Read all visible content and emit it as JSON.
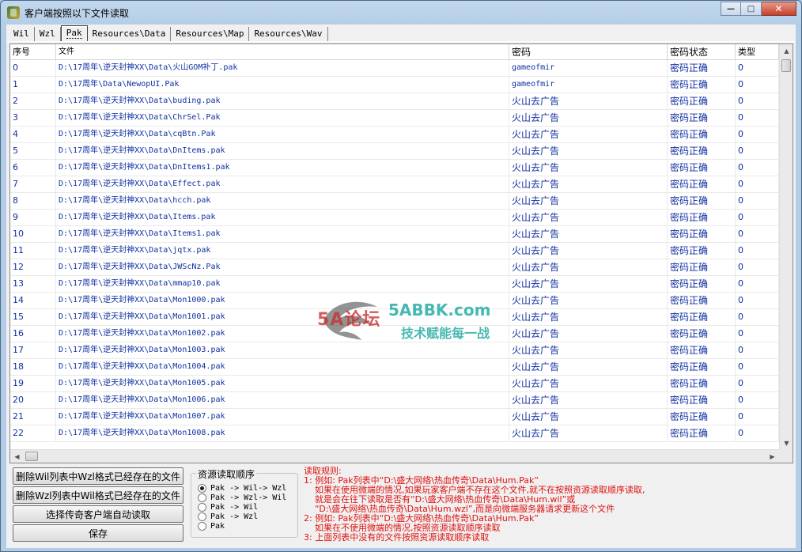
{
  "window": {
    "title": "客户端按照以下文件读取",
    "controls": {
      "minimize": "—",
      "maximize": "□",
      "close": "✕"
    }
  },
  "tabs": [
    {
      "label": "Wil",
      "active": false
    },
    {
      "label": "Wzl",
      "active": false
    },
    {
      "label": "Pak",
      "active": true
    },
    {
      "label": "Resources\\Data",
      "active": false
    },
    {
      "label": "Resources\\Map",
      "active": false
    },
    {
      "label": "Resources\\Wav",
      "active": false
    }
  ],
  "table": {
    "columns": [
      "序号",
      "文件",
      "密码",
      "密码状态",
      "类型"
    ],
    "rows": [
      [
        "0",
        "D:\\17周年\\逆天封神XX\\Data\\火山GOM补丁.pak",
        "gameofmir",
        "密码正确",
        "0"
      ],
      [
        "1",
        "D:\\17周年\\Data\\NewopUI.Pak",
        "gameofmir",
        "密码正确",
        "0"
      ],
      [
        "2",
        "D:\\17周年\\逆天封神XX\\Data\\buding.pak",
        "火山去广告",
        "密码正确",
        "0"
      ],
      [
        "3",
        "D:\\17周年\\逆天封神XX\\Data\\ChrSel.Pak",
        "火山去广告",
        "密码正确",
        "0"
      ],
      [
        "4",
        "D:\\17周年\\逆天封神XX\\Data\\cqBtn.Pak",
        "火山去广告",
        "密码正确",
        "0"
      ],
      [
        "5",
        "D:\\17周年\\逆天封神XX\\Data\\DnItems.pak",
        "火山去广告",
        "密码正确",
        "0"
      ],
      [
        "6",
        "D:\\17周年\\逆天封神XX\\Data\\DnItems1.pak",
        "火山去广告",
        "密码正确",
        "0"
      ],
      [
        "7",
        "D:\\17周年\\逆天封神XX\\Data\\Effect.pak",
        "火山去广告",
        "密码正确",
        "0"
      ],
      [
        "8",
        "D:\\17周年\\逆天封神XX\\Data\\hcch.pak",
        "火山去广告",
        "密码正确",
        "0"
      ],
      [
        "9",
        "D:\\17周年\\逆天封神XX\\Data\\Items.pak",
        "火山去广告",
        "密码正确",
        "0"
      ],
      [
        "10",
        "D:\\17周年\\逆天封神XX\\Data\\Items1.pak",
        "火山去广告",
        "密码正确",
        "0"
      ],
      [
        "11",
        "D:\\17周年\\逆天封神XX\\Data\\jqtx.pak",
        "火山去广告",
        "密码正确",
        "0"
      ],
      [
        "12",
        "D:\\17周年\\逆天封神XX\\Data\\JWScNz.Pak",
        "火山去广告",
        "密码正确",
        "0"
      ],
      [
        "13",
        "D:\\17周年\\逆天封神XX\\Data\\mmap10.pak",
        "火山去广告",
        "密码正确",
        "0"
      ],
      [
        "14",
        "D:\\17周年\\逆天封神XX\\Data\\Mon1000.pak",
        "火山去广告",
        "密码正确",
        "0"
      ],
      [
        "15",
        "D:\\17周年\\逆天封神XX\\Data\\Mon1001.pak",
        "火山去广告",
        "密码正确",
        "0"
      ],
      [
        "16",
        "D:\\17周年\\逆天封神XX\\Data\\Mon1002.pak",
        "火山去广告",
        "密码正确",
        "0"
      ],
      [
        "17",
        "D:\\17周年\\逆天封神XX\\Data\\Mon1003.pak",
        "火山去广告",
        "密码正确",
        "0"
      ],
      [
        "18",
        "D:\\17周年\\逆天封神XX\\Data\\Mon1004.pak",
        "火山去广告",
        "密码正确",
        "0"
      ],
      [
        "19",
        "D:\\17周年\\逆天封神XX\\Data\\Mon1005.pak",
        "火山去广告",
        "密码正确",
        "0"
      ],
      [
        "20",
        "D:\\17周年\\逆天封神XX\\Data\\Mon1006.pak",
        "火山去广告",
        "密码正确",
        "0"
      ],
      [
        "21",
        "D:\\17周年\\逆天封神XX\\Data\\Mon1007.pak",
        "火山去广告",
        "密码正确",
        "0"
      ],
      [
        "22",
        "D:\\17周年\\逆天封神XX\\Data\\Mon1008.pak",
        "火山去广告",
        "密码正确",
        "0"
      ]
    ]
  },
  "watermark": {
    "logo": "5A论坛",
    "domain": "5ABBK.com",
    "slogan": "技术赋能每一战"
  },
  "buttons": {
    "delete_wil": "删除Wil列表中Wzl格式已经存在的文件",
    "delete_wzl": "删除Wzl列表中Wil格式已经存在的文件",
    "auto_read": "选择传奇客户端自动读取",
    "save": "保存"
  },
  "resource_order": {
    "title": "资源读取顺序",
    "options": [
      {
        "label": "Pak -> Wil-> Wzl",
        "checked": true
      },
      {
        "label": "Pak -> Wzl-> Wil",
        "checked": false
      },
      {
        "label": "Pak -> Wil",
        "checked": false
      },
      {
        "label": "Pak -> Wzl",
        "checked": false
      },
      {
        "label": "Pak",
        "checked": false
      }
    ]
  },
  "rules": {
    "heading": "读取规则:",
    "lines": [
      "1: 例如: Pak列表中“D:\\盛大网络\\热血传奇\\Data\\Hum.Pak”",
      "    如果在使用微端的情况,如果玩家客户端不存在这个文件,就不在按照资源读取顺序读取,",
      "    就是会在往下读取是否有“D:\\盛大网络\\热血传奇\\Data\\Hum.wil”或",
      "    “D:\\盛大网络\\热血传奇\\Data\\Hum.wzl”,而是向微端服务器请求更新这个文件",
      "2: 例如: Pak列表中“D:\\盛大网络\\热血传奇\\Data\\Hum.Pak”",
      "    如果在不使用微端的情况,按照资源读取顺序读取",
      "3: 上面列表中没有的文件按照资源读取顺序读取"
    ]
  }
}
